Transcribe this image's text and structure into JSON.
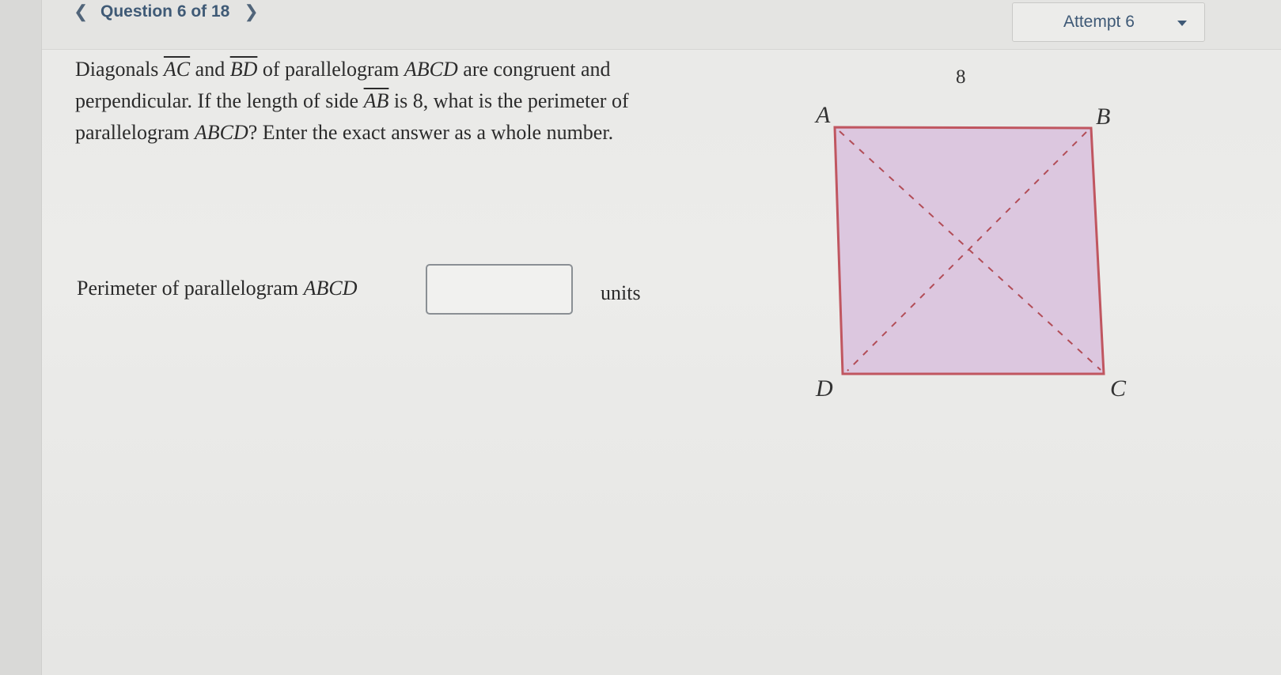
{
  "nav": {
    "prev_icon": "chevron-left-icon",
    "label": "Question 6 of 18",
    "next_icon": "chevron-right-icon"
  },
  "attempt": {
    "label": "Attempt 6",
    "icon": "caret-down-icon"
  },
  "question": {
    "t1": "Diagonals ",
    "ac": "AC",
    "t2": " and ",
    "bd": "BD",
    "t3": " of parallelogram ",
    "abcd1": "ABCD",
    "t4": " are congruent and perpendicular. If the length of side ",
    "ab": "AB",
    "t5": " is 8, what is the perimeter of parallelogram ",
    "abcd2": "ABCD",
    "t6": "? Enter the exact answer as a whole number."
  },
  "answer": {
    "label_prefix": "Perimeter of parallelogram ",
    "label_var": "ABCD",
    "value": "",
    "units": "units"
  },
  "figure": {
    "side_label": "8",
    "vertices": {
      "a": "A",
      "b": "B",
      "c": "C",
      "d": "D"
    },
    "fill_color": "#dcc7df",
    "edge_color": "#c05660",
    "diagonal_color": "#b24d57"
  }
}
